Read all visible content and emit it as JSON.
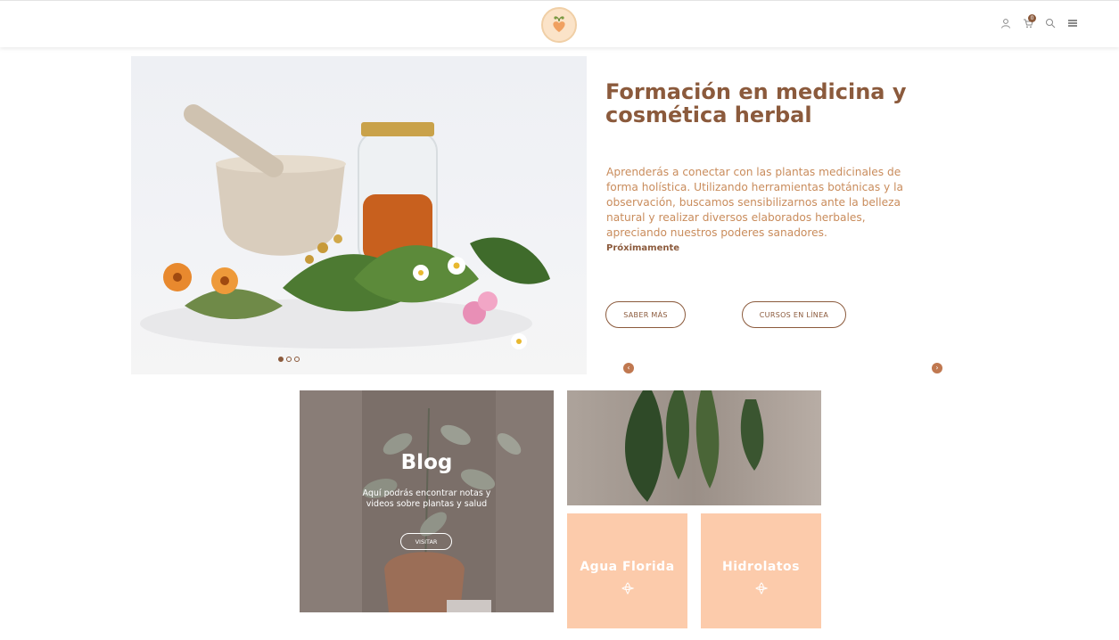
{
  "header": {
    "logo_name": "herbal-logo",
    "icons": [
      "user-icon",
      "cart-icon",
      "search-icon",
      "menu-icon"
    ],
    "cart_count": "0"
  },
  "hero": {
    "title": "Formación en medicina y cosmética herbal",
    "description": "Aprenderás a conectar con las plantas medicinales de forma holística. Utilizando herramientas botánicas y la observación, buscamos sensibilizarnos ante la belleza natural y realizar diversos elaborados herbales, apreciando nuestros poderes sanadores.",
    "soon": "Próximamente",
    "btn_more": "SABER MÁS",
    "btn_courses": "CURSOS EN LÍNEA",
    "slide_count": 3,
    "active_slide": 1
  },
  "tiles": {
    "blog": {
      "title": "Blog",
      "desc": "Aquí podrás encontrar notas y videos sobre plantas y salud",
      "btn": "VISITAR"
    },
    "agua": {
      "label": "Agua Florida"
    },
    "hidro": {
      "label": "Hidrolatos"
    }
  },
  "colors": {
    "brand_brown": "#8b5a3c",
    "text_tan": "#c98c5c",
    "peach": "#fccbab",
    "arrow": "#c07850"
  }
}
